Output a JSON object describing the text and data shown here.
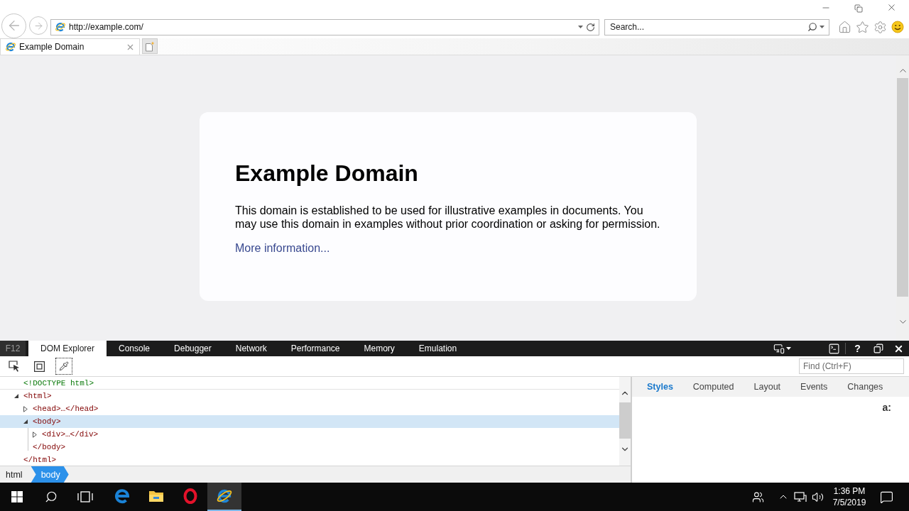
{
  "browser": {
    "address": {
      "value": "http://example.com/"
    },
    "search": {
      "placeholder": "Search..."
    },
    "tabs": [
      {
        "label": "Example Domain",
        "selected": true
      }
    ]
  },
  "page": {
    "heading": "Example Domain",
    "paragraph": "This domain is established to be used for illustrative examples in documents. You may use this domain in examples without prior coordination or asking for permission.",
    "link": "More information..."
  },
  "devtools": {
    "label": "F12",
    "tabs": [
      {
        "label": "DOM Explorer",
        "selected": true
      },
      {
        "label": "Console",
        "selected": false
      },
      {
        "label": "Debugger",
        "selected": false
      },
      {
        "label": "Network",
        "selected": false
      },
      {
        "label": "Performance",
        "selected": false
      },
      {
        "label": "Memory",
        "selected": false
      },
      {
        "label": "Emulation",
        "selected": false
      }
    ],
    "help": "?",
    "tools": [
      {
        "kind": "select-element",
        "focused": false
      },
      {
        "kind": "box-model",
        "focused": false
      },
      {
        "kind": "eyedropper",
        "focused": true
      }
    ],
    "find": {
      "placeholder": "Find (Ctrl+F)"
    },
    "dom_tree": [
      {
        "kind": "doctype",
        "text": "<!DOCTYPE html>",
        "selected": false
      },
      {
        "kind": "element",
        "text": "<html>",
        "expanded": true,
        "selected": false,
        "children": [
          {
            "kind": "element",
            "text": "<head>…</head>",
            "expanded": false,
            "selected": false
          },
          {
            "kind": "element",
            "text": "<body>",
            "expanded": true,
            "selected": true,
            "children": [
              {
                "kind": "element",
                "text": "<div>…</div>",
                "expanded": false,
                "selected": false
              }
            ],
            "closing": "</body>"
          }
        ],
        "closing": "</html>"
      }
    ],
    "breadcrumb": [
      {
        "label": "html",
        "selected": false
      },
      {
        "label": "body",
        "selected": true
      }
    ],
    "side_tabs": [
      {
        "label": "Styles",
        "selected": true
      },
      {
        "label": "Computed",
        "selected": false
      },
      {
        "label": "Layout",
        "selected": false
      },
      {
        "label": "Events",
        "selected": false
      },
      {
        "label": "Changes",
        "selected": false
      }
    ],
    "state_toggle": "a:"
  },
  "taskbar": {
    "apps": [
      {
        "kind": "edge",
        "active": false
      },
      {
        "kind": "folder",
        "active": false
      },
      {
        "kind": "opera",
        "active": false
      },
      {
        "kind": "ie",
        "active": true
      }
    ],
    "clock": {
      "time": "1:36 PM",
      "date": "7/5/2019"
    }
  }
}
